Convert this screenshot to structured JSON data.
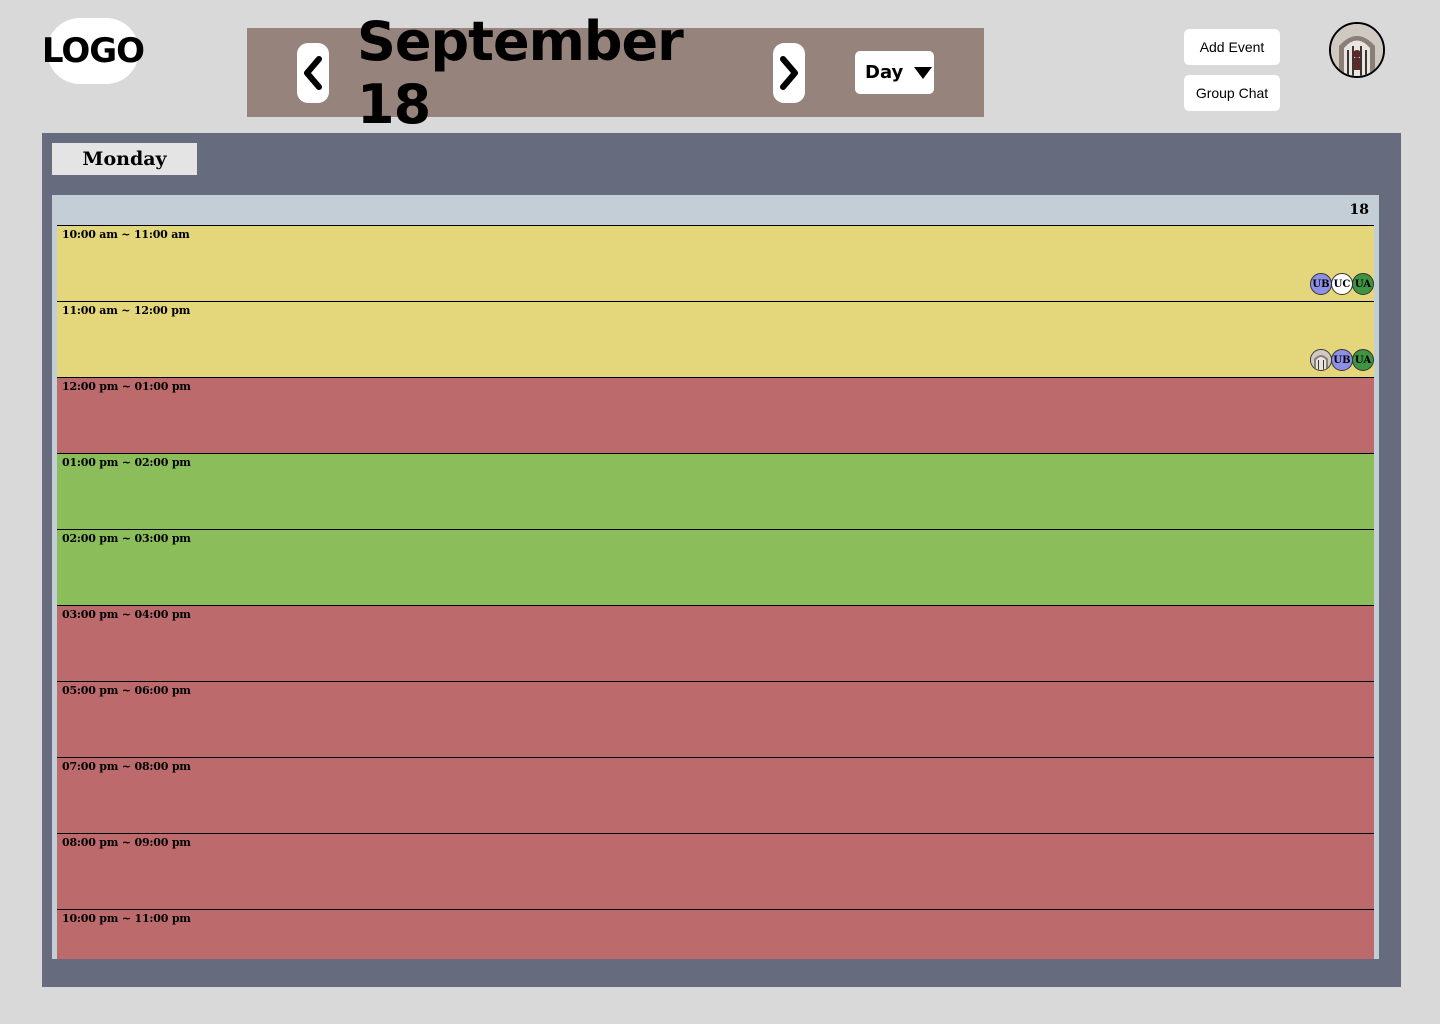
{
  "header": {
    "logo_text": "LOGO",
    "date_title": "September 18",
    "prev_icon": "chevron-left-icon",
    "next_icon": "chevron-right-icon",
    "view_select": {
      "value": "Day",
      "icon": "caret-down-icon"
    },
    "add_event_label": "Add Event",
    "group_chat_label": "Group Chat",
    "profile_avatar_icon": "profile-photo"
  },
  "calendar": {
    "day_name": "Monday",
    "day_number": "18",
    "colors": {
      "maybe": "#e3d67b",
      "busy": "#bc6a6b",
      "free": "#8bbe5b"
    },
    "slots": [
      {
        "time": "10:00 am ~ 11:00 am",
        "status": "maybe",
        "attendees": [
          {
            "initials": "UB",
            "color": "#8e90e8"
          },
          {
            "initials": "UC",
            "color": "#ffffff"
          },
          {
            "initials": "UA",
            "color": "#3f9441"
          }
        ]
      },
      {
        "time": "11:00 am ~ 12:00 pm",
        "status": "maybe",
        "attendees": [
          {
            "initials": "",
            "color": "#c9c3bd",
            "photo": true
          },
          {
            "initials": "UB",
            "color": "#8e90e8"
          },
          {
            "initials": "UA",
            "color": "#3f9441"
          }
        ]
      },
      {
        "time": "12:00 pm ~ 01:00 pm",
        "status": "busy",
        "attendees": []
      },
      {
        "time": "01:00 pm ~ 02:00 pm",
        "status": "free",
        "attendees": []
      },
      {
        "time": "02:00 pm ~ 03:00 pm",
        "status": "free",
        "attendees": []
      },
      {
        "time": "03:00 pm ~ 04:00 pm",
        "status": "busy",
        "attendees": []
      },
      {
        "time": "05:00 pm ~ 06:00 pm",
        "status": "busy",
        "attendees": []
      },
      {
        "time": "07:00 pm ~ 08:00 pm",
        "status": "busy",
        "attendees": []
      },
      {
        "time": "08:00 pm ~ 09:00 pm",
        "status": "busy",
        "attendees": []
      },
      {
        "time": "10:00 pm ~ 11:00 pm",
        "status": "busy",
        "attendees": []
      }
    ]
  }
}
